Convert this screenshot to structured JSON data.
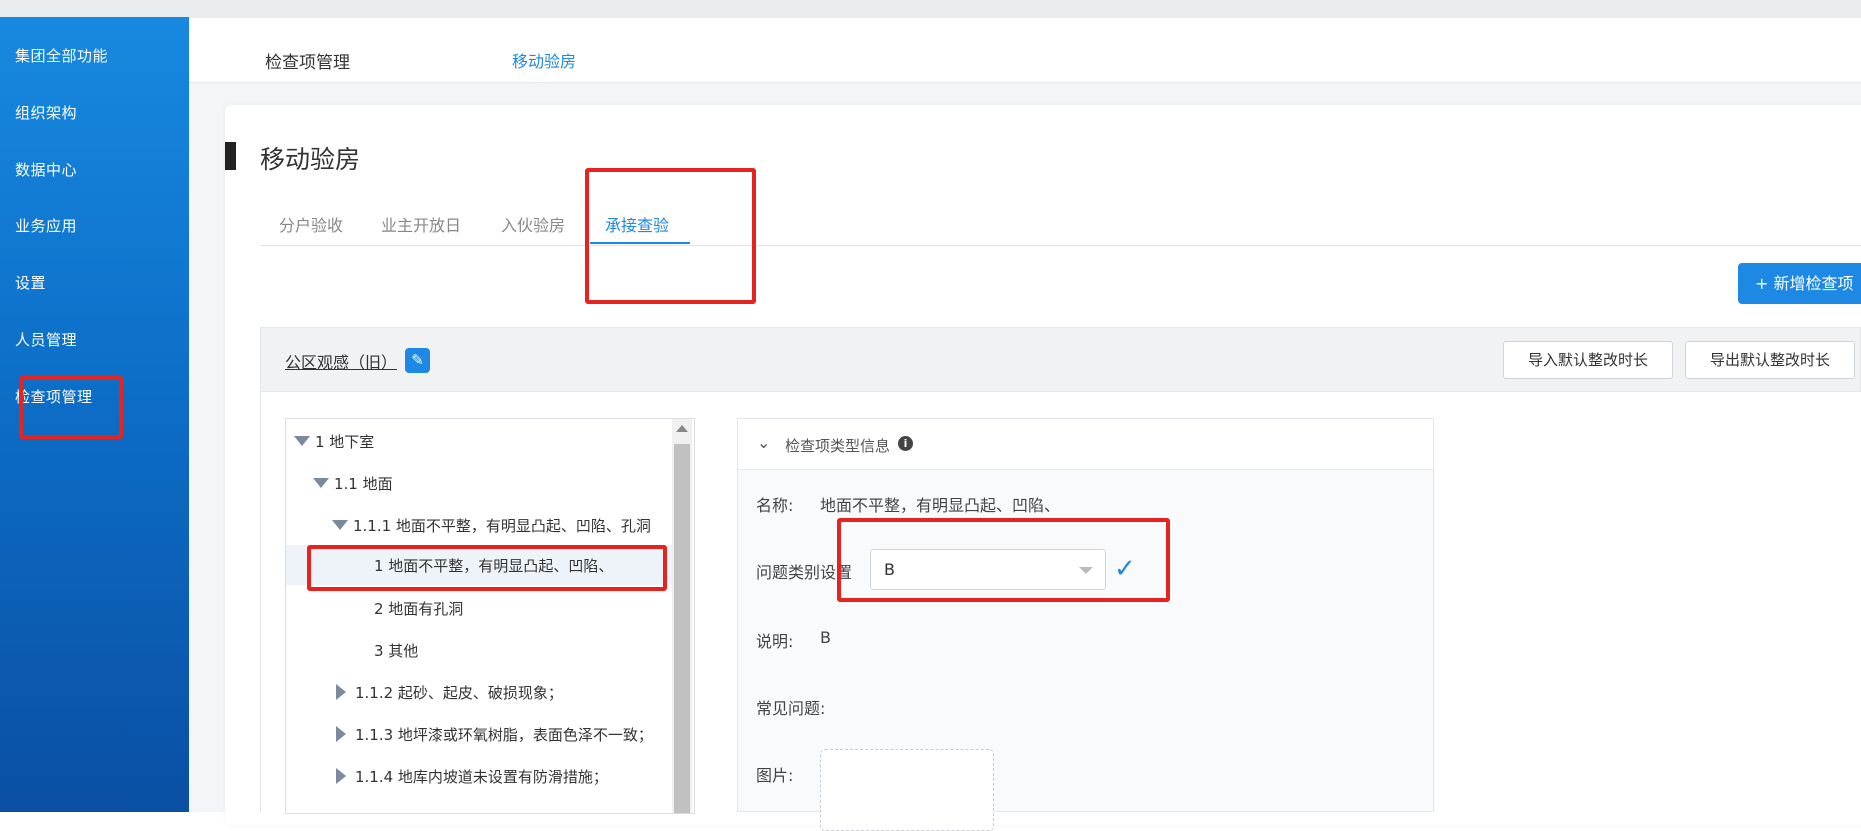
{
  "sidebar": {
    "items": [
      {
        "label": "集团全部功能"
      },
      {
        "label": "组织架构"
      },
      {
        "label": "数据中心"
      },
      {
        "label": "业务应用"
      },
      {
        "label": "设置"
      },
      {
        "label": "人员管理"
      },
      {
        "label": "检查项管理"
      }
    ]
  },
  "header": {
    "crumb1": "检查项管理",
    "crumb2": "移动验房"
  },
  "page": {
    "title": "移动验房",
    "tabs": [
      {
        "label": "分户验收"
      },
      {
        "label": "业主开放日"
      },
      {
        "label": "入伙验房"
      },
      {
        "label": "承接查验",
        "active": true
      }
    ],
    "add_button": "新增检查项"
  },
  "panel": {
    "name": "公区观感（旧）",
    "import_button": "导入默认整改时长",
    "export_button": "导出默认整改时长"
  },
  "tree": {
    "nodes": [
      {
        "label": "1 地下室"
      },
      {
        "label": "1.1 地面"
      },
      {
        "label": "1.1.1 地面不平整，有明显凸起、凹陷、孔洞"
      },
      {
        "label": "1 地面不平整，有明显凸起、凹陷、"
      },
      {
        "label": "2 地面有孔洞"
      },
      {
        "label": "3 其他"
      },
      {
        "label": "1.1.2 起砂、起皮、破损现象；"
      },
      {
        "label": "1.1.3 地坪漆或环氧树脂，表面色泽不一致；"
      },
      {
        "label": "1.1.4 地库内坡道未设置有防滑措施；"
      }
    ]
  },
  "detail": {
    "section_label": "检查项类型信息",
    "name_label": "名称:",
    "name_value": "地面不平整，有明显凸起、凹陷、",
    "category_label": "问题类别设置",
    "category_value": "B",
    "desc_label": "说明:",
    "desc_value": "B",
    "common_label": "常见问题:",
    "image_label": "图片:"
  },
  "colors": {
    "accent": "#1e88e5",
    "highlight": "#e8231f",
    "sidebar_top": "#1889e0",
    "sidebar_bottom": "#0a4fa4"
  }
}
